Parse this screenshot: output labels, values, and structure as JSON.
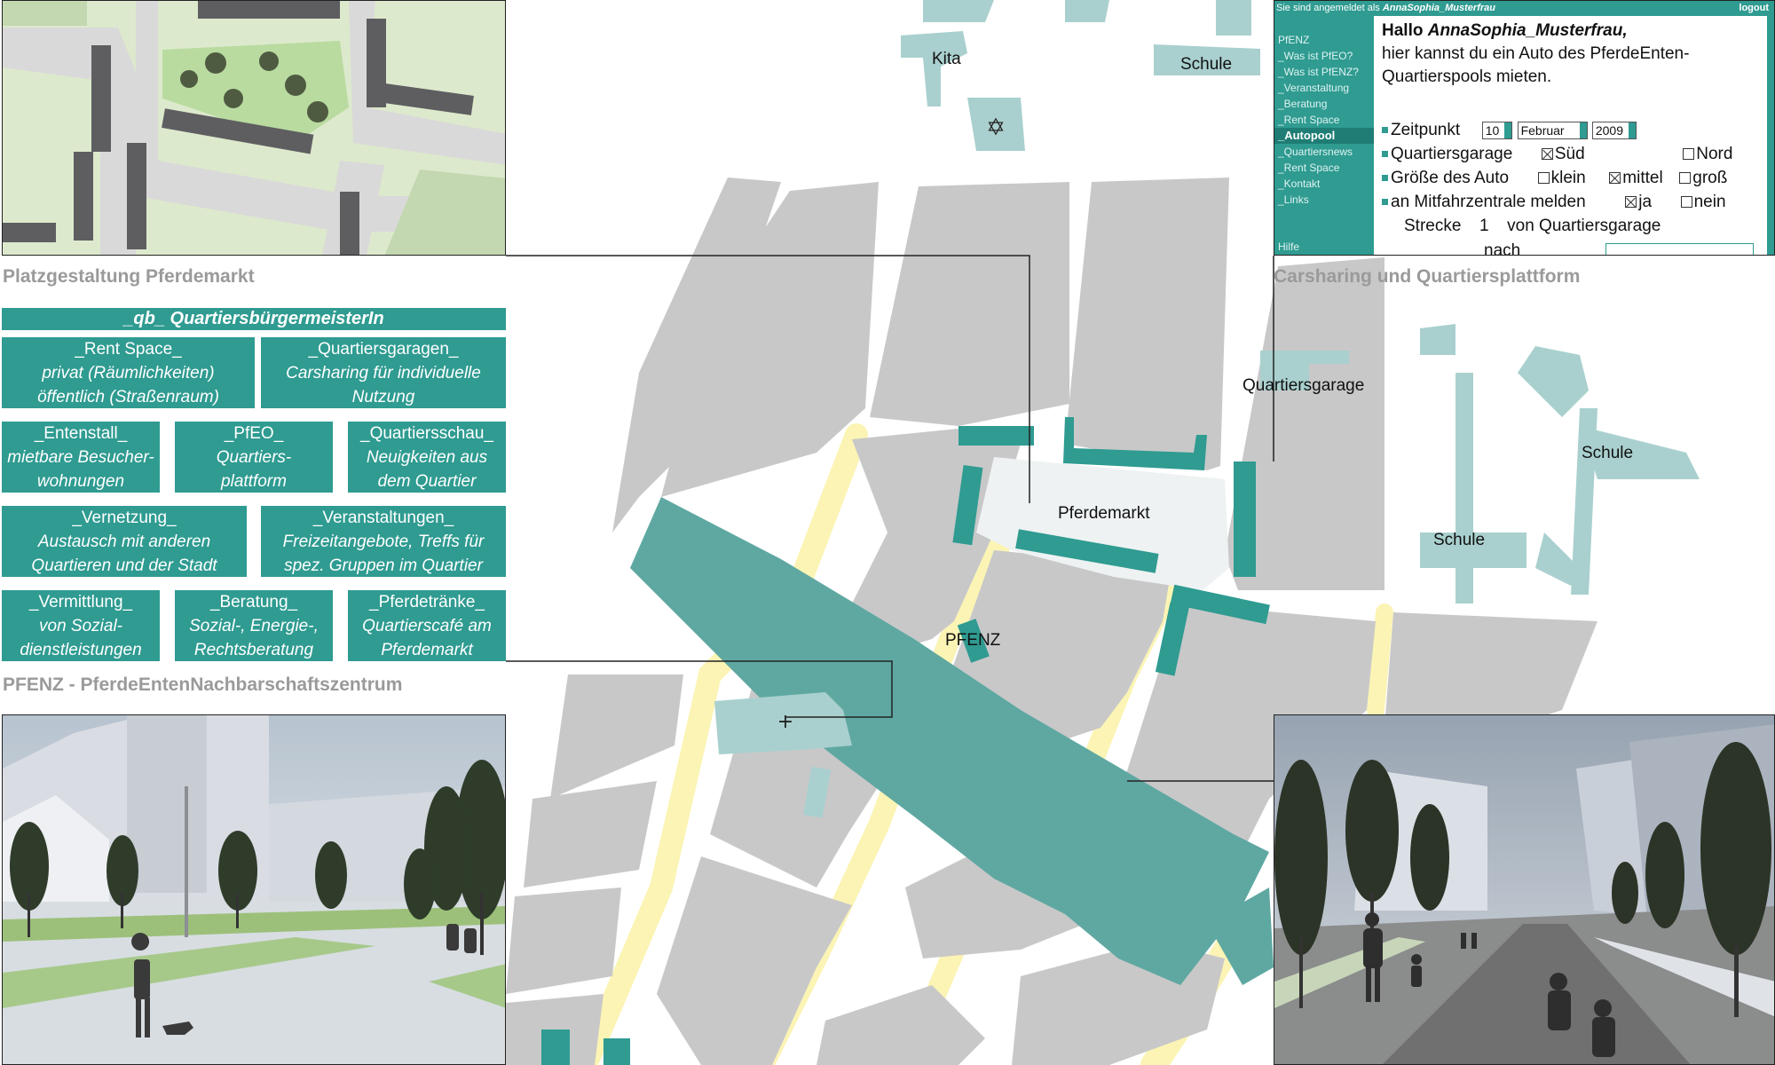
{
  "map": {
    "labels": {
      "kita": "Kita",
      "schule_top": "Schule",
      "quartiersgarage": "Quartiersgarage",
      "schule_right": "Schule",
      "schule_lower": "Schule",
      "pferdemarkt": "Pferdemarkt",
      "pfenz": "PFENZ"
    },
    "colors": {
      "block": "#c8c8c9",
      "teal": "#5fa8a2",
      "light_teal": "#a9d0ce",
      "yellow": "#fbf4b4",
      "plaza": "#eef2f2"
    }
  },
  "captions": {
    "platz": "Platzgestaltung Pferdemarkt",
    "carsharing": "Carsharing und Quartiersplattform",
    "pfenz": "PFENZ - PferdeEntenNachbarschaftszentrum"
  },
  "board": {
    "title": "_qb_ QuartiersbürgermeisterIn",
    "tiles": [
      {
        "head": "_Rent Space_",
        "line1": "privat (Räumlichkeiten)",
        "line2": "öffentlich (Straßenraum)"
      },
      {
        "head": "_Quartiersgaragen_",
        "line1": "Carsharing für individuelle",
        "line2": "Nutzung"
      },
      {
        "head": "_Entenstall_",
        "line1": "mietbare Besucher-",
        "line2": "wohnungen"
      },
      {
        "head": "_PfEO_",
        "line1": "Quartiers-",
        "line2": "plattform"
      },
      {
        "head": "_Quartiersschau_",
        "line1": "Neuigkeiten aus",
        "line2": "dem Quartier"
      },
      {
        "head": "_Vernetzung_",
        "line1": "Austausch mit anderen",
        "line2": "Quartieren und der Stadt"
      },
      {
        "head": "_Veranstaltungen_",
        "line1": "Freizeitangebote, Treffs für",
        "line2": "spez. Gruppen im Quartier"
      },
      {
        "head": "_Vermittlung_",
        "line1": "von Sozial-",
        "line2": "dienstleistungen"
      },
      {
        "head": "_Beratung_",
        "line1": "Sozial-, Energie-,",
        "line2": "Rechtsberatung"
      },
      {
        "head": "_Pferdetränke_",
        "line1": "Quartierscafé am",
        "line2": "Pferdemarkt"
      }
    ]
  },
  "webform": {
    "login_prefix": "Sie sind angemeldet als",
    "login_user": "AnnaSophia_Musterfrau",
    "logout": "logout",
    "nav": [
      "PfENZ",
      "_Was ist PfEO?",
      "_Was ist PfENZ?",
      "_Veranstaltung",
      "_Beratung",
      "_Rent Space",
      "_Autopool",
      "_Quartiersnews",
      "_Rent Space",
      "_Kontakt",
      "_Links"
    ],
    "nav_active": "_Autopool",
    "help": "Hilfe",
    "greeting_hallo": "Hallo",
    "greeting_name": "AnnaSophia_Musterfrau,",
    "intro_line1": "hier kannst du ein Auto des PferdeEnten-",
    "intro_line2": "Quartierspools mieten.",
    "zeitpunkt_label": "Zeitpunkt",
    "day": "10",
    "month": "Februar",
    "year": "2009",
    "garage_label": "Quartiersgarage",
    "garage_sued": "Süd",
    "garage_nord": "Nord",
    "groesse_label": "Größe des Auto",
    "size_klein": "klein",
    "size_mittel": "mittel",
    "size_gross": "groß",
    "mitfahr_label": "an Mitfahrzentrale melden",
    "mitfahr_ja": "ja",
    "mitfahr_nein": "nein",
    "strecke_label": "Strecke",
    "strecke_nr": "1",
    "strecke_von": "von Quartiersgarage",
    "nach_label": "nach",
    "checked": {
      "sued": true,
      "nord": false,
      "klein": false,
      "mittel": true,
      "gross": false,
      "ja": true,
      "nein": false
    },
    "accent": "#2f9b91"
  }
}
